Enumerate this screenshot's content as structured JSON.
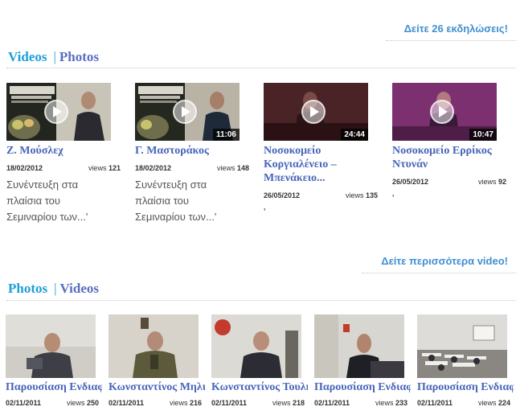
{
  "events_link": "Δείτε 26 εκδηλώσεις!",
  "videos_section": {
    "tab_active": "Videos",
    "tab_separator": "|",
    "tab_inactive": "Photos",
    "items": [
      {
        "title": "Ζ. Μούσλεχ",
        "date": "18/02/2012",
        "views_label": "views",
        "views": "121",
        "duration": "",
        "description": "Συνέντευξη στα πλαίσια του Σεμιναρίου των...'"
      },
      {
        "title": "Γ. Μαστοράκος",
        "date": "18/02/2012",
        "views_label": "views",
        "views": "148",
        "duration": "11:06",
        "description": "Συνέντευξη στα πλαίσια του Σεμιναρίου των...'"
      },
      {
        "title": "Νοσοκομείο Κοργιαλένειο – Μπενάκειο...",
        "date": "26/05/2012",
        "views_label": "views",
        "views": "135",
        "duration": "24:44",
        "description": "'"
      },
      {
        "title": "Νοσοκομείο Ερρίκος Ντυνάν",
        "date": "26/05/2012",
        "views_label": "views",
        "views": "92",
        "duration": "10:47",
        "description": "'"
      }
    ],
    "more_link": "Δείτε περισσότερα video!"
  },
  "photos_section": {
    "tab_active": "Photos",
    "tab_separator": "|",
    "tab_inactive": "Videos",
    "items": [
      {
        "title": "Παρουσίαση Ενδιαφερόντων",
        "date": "02/11/2011",
        "views_label": "views",
        "views": "250"
      },
      {
        "title": "Κωνσταντίνος Μηλιάς",
        "date": "02/11/2011",
        "views_label": "views",
        "views": "216"
      },
      {
        "title": "Κωνσταντίνος Τουλής",
        "date": "02/11/2011",
        "views_label": "views",
        "views": "218"
      },
      {
        "title": "Παρουσίαση Ενδιαφερόντων",
        "date": "02/11/2011",
        "views_label": "views",
        "views": "233"
      },
      {
        "title": "Παρουσίαση Ενδιαφερόντων",
        "date": "02/11/2011",
        "views_label": "views",
        "views": "224"
      }
    ]
  },
  "colors": {
    "tab_active": "#1d9fd6",
    "tab_inactive": "#5a6ec0",
    "link": "#3f8fd2",
    "title": "#4765b8"
  }
}
